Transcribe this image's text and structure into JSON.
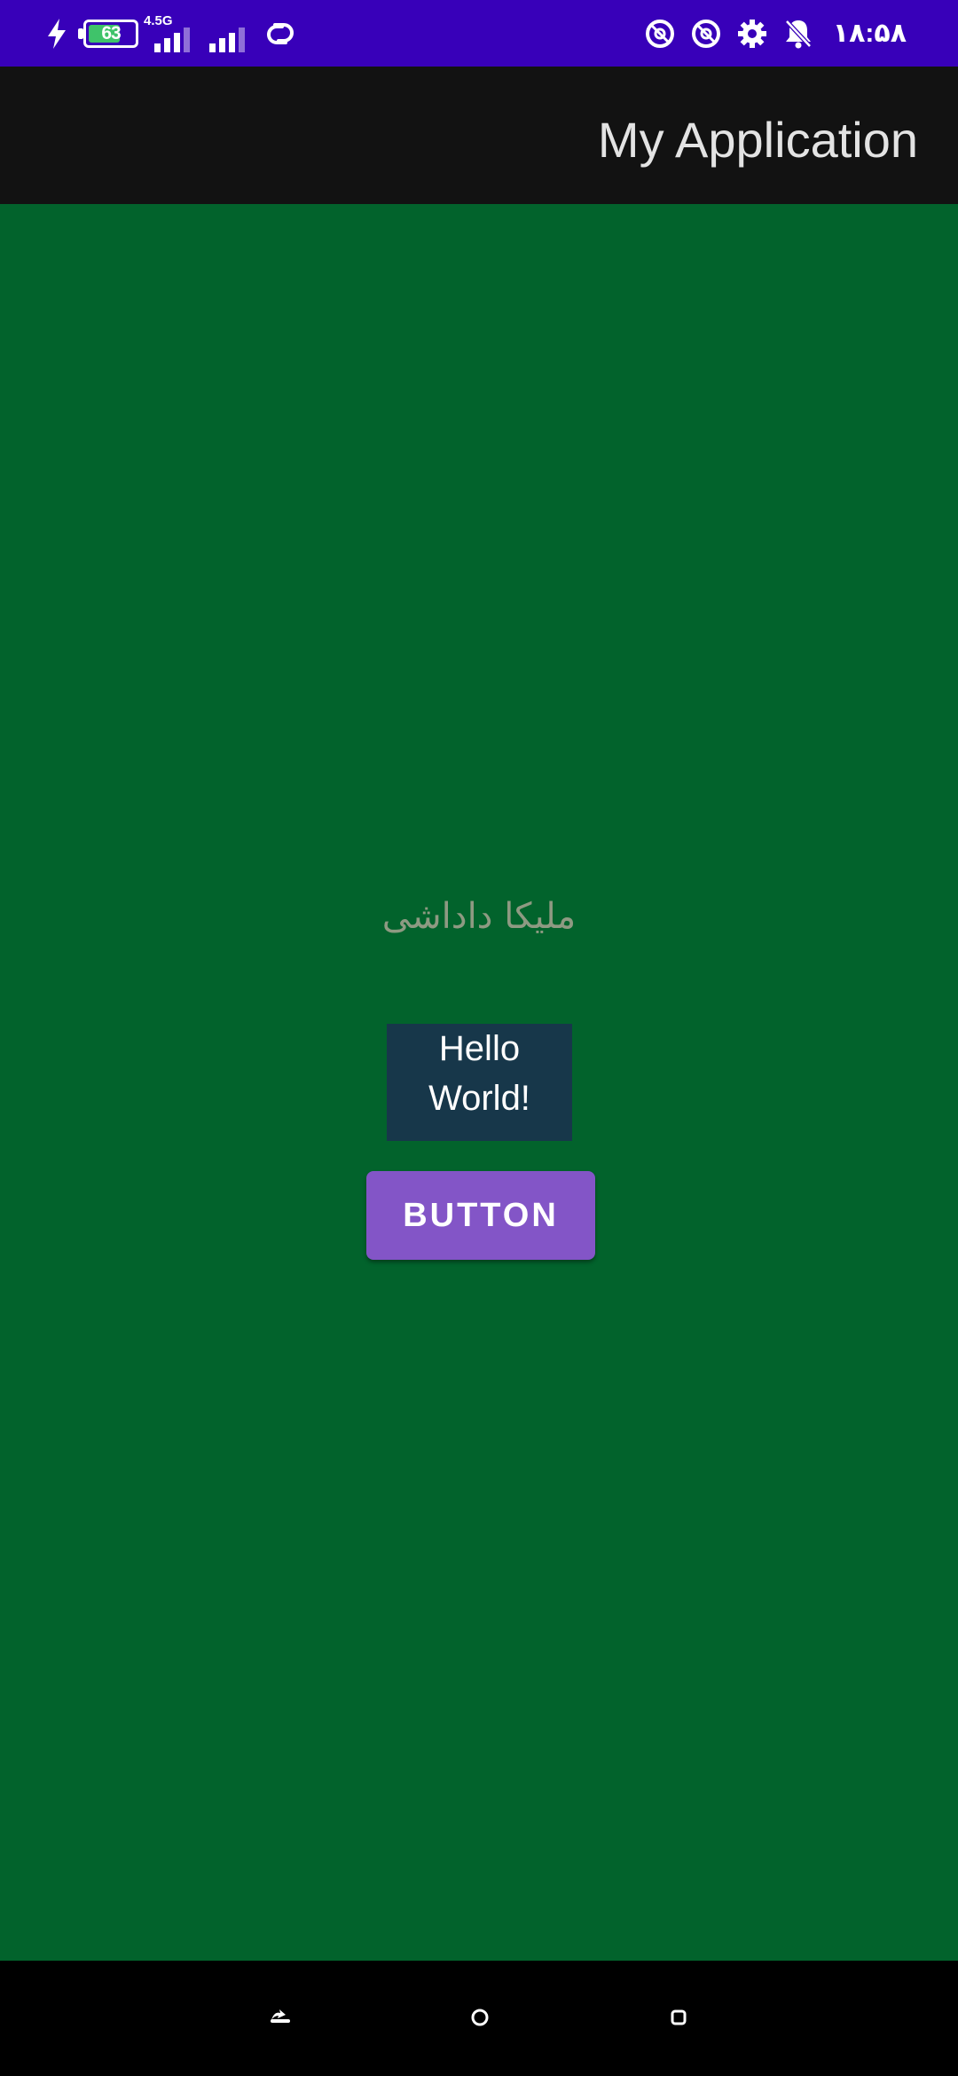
{
  "status_bar": {
    "battery_percent": "63",
    "network_type": "4.5G",
    "time": "۱۸:۵۸",
    "left_icons": [
      "charging-icon",
      "battery-icon",
      "signal-icon",
      "signal-icon",
      "link-icon"
    ],
    "right_icons": [
      "at-sign-icon",
      "at-sign-icon",
      "gear-icon",
      "bell-mute-icon"
    ],
    "background_color": "#3800b9"
  },
  "app_bar": {
    "title": "My Application",
    "background_color": "#121212"
  },
  "content": {
    "background_color": "#02632c",
    "name_label": "ملیکا داداشی",
    "hello_text": "Hello World!",
    "button_label": "BUTTON",
    "button_color": "#8355c7",
    "hello_box_color": "#17374a"
  },
  "nav_bar": {
    "buttons": [
      "back-icon",
      "home-icon",
      "recents-icon"
    ]
  }
}
